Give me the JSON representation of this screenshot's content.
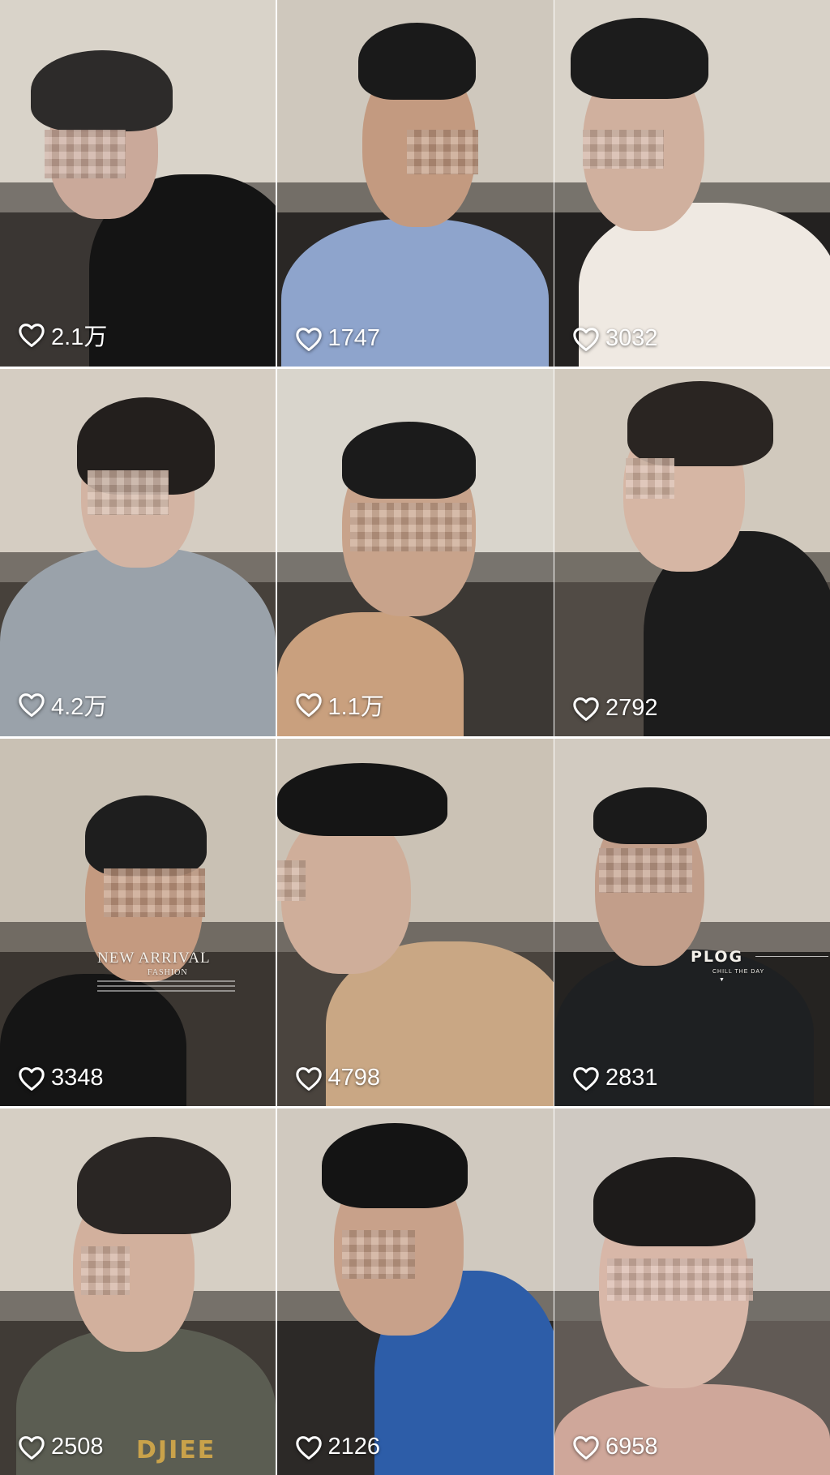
{
  "grid": {
    "items": [
      {
        "likes": "2.1万",
        "colors": {
          "top": "#d9d3c9",
          "bottom": "#3a3633",
          "skin": "#caa99a",
          "hair": "#2d2b2a",
          "shirt": "#141414"
        }
      },
      {
        "likes": "1747",
        "colors": {
          "top": "#cfc8bd",
          "bottom": "#2a2725",
          "skin": "#c39a80",
          "hair": "#1a1a1a",
          "shirt": "#8ea4cc"
        }
      },
      {
        "likes": "3032",
        "colors": {
          "top": "#d8d2c8",
          "bottom": "#232120",
          "skin": "#d0b09e",
          "hair": "#1c1c1c",
          "shirt": "#efe9e2"
        }
      },
      {
        "likes": "4.2万",
        "colors": {
          "top": "#d5cdc2",
          "bottom": "#47413b",
          "skin": "#d3b4a3",
          "hair": "#231f1d",
          "shirt": "#9aa2aa"
        }
      },
      {
        "likes": "1.1万",
        "colors": {
          "top": "#d9d5cc",
          "bottom": "#3c3834",
          "skin": "#c8a38b",
          "hair": "#1b1b1b",
          "shirt": "#c9a07e"
        }
      },
      {
        "likes": "2792",
        "colors": {
          "top": "#d1c9bd",
          "bottom": "#514b45",
          "skin": "#d6b6a4",
          "hair": "#2a2522",
          "shirt": "#1c1c1c"
        }
      },
      {
        "likes": "3348",
        "colors": {
          "top": "#c9c1b4",
          "bottom": "#3b3631",
          "skin": "#c49a80",
          "hair": "#1e1e1e",
          "shirt": "#151515"
        }
      },
      {
        "likes": "4798",
        "colors": {
          "top": "#cbc2b5",
          "bottom": "#4a443e",
          "skin": "#cfae9a",
          "hair": "#151515",
          "shirt": "#c9a784"
        }
      },
      {
        "likes": "2831",
        "colors": {
          "top": "#d2cbc1",
          "bottom": "#252321",
          "skin": "#c29e8a",
          "hair": "#1a1a1a",
          "shirt": "#1e2022"
        }
      },
      {
        "likes": "2508",
        "colors": {
          "top": "#d6cfc4",
          "bottom": "#403b36",
          "skin": "#d2b09d",
          "hair": "#2a2624",
          "shirt": "#5b5d52"
        }
      },
      {
        "likes": "2126",
        "colors": {
          "top": "#d0c9bf",
          "bottom": "#2c2927",
          "skin": "#c8a18a",
          "hair": "#141414",
          "shirt": "#2d5da8"
        }
      },
      {
        "likes": "6958",
        "colors": {
          "top": "#cfc9c2",
          "bottom": "#615a55",
          "skin": "#d8b7a8",
          "hair": "#1d1b1a",
          "shirt": "#cfa79a"
        }
      }
    ]
  },
  "overlays": {
    "new_arrival": {
      "title": "NEW ARRIVAL",
      "subtitle": "FASHION"
    },
    "plog": {
      "title": "PLOG",
      "subtitle": "CHILL THE DAY"
    },
    "shirt_print": "DJIEE"
  },
  "icons": {
    "like": "heart-outline-icon"
  }
}
